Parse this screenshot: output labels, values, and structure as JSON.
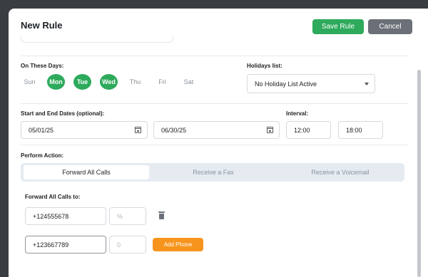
{
  "modal": {
    "title": "New Rule",
    "save_label": "Save Rule",
    "cancel_label": "Cancel"
  },
  "days": {
    "label": "On These Days:",
    "items": [
      {
        "label": "Sun",
        "selected": false
      },
      {
        "label": "Mon",
        "selected": true
      },
      {
        "label": "Tue",
        "selected": true
      },
      {
        "label": "Wed",
        "selected": true
      },
      {
        "label": "Thu",
        "selected": false
      },
      {
        "label": "Fri",
        "selected": false
      },
      {
        "label": "Sat",
        "selected": false
      }
    ]
  },
  "holidays": {
    "label": "Holidays list:",
    "value": "No Holiday List Active"
  },
  "dates": {
    "label": "Start and End Dates (optional):",
    "start": "05/01/25",
    "end": "06/30/25"
  },
  "interval": {
    "label": "Interval:",
    "start": "12:00",
    "end": "18:00"
  },
  "action": {
    "label": "Perform Action:",
    "tabs": [
      "Forward All Calls",
      "Receive a Fax",
      "Receive a Voicemail"
    ],
    "active_tab": "Forward All Calls"
  },
  "forward": {
    "label": "Forward All Calls to:",
    "rows": [
      {
        "phone": "+124555678",
        "percent_placeholder": "%"
      },
      {
        "phone": "+123667789",
        "percent_value": "0"
      }
    ],
    "add_label": "Add Phone"
  },
  "colors": {
    "accent_green": "#2eaa5c",
    "cancel_gray": "#6b7078",
    "add_orange": "#f7941d",
    "tab_bar": "#e6ebf2"
  }
}
